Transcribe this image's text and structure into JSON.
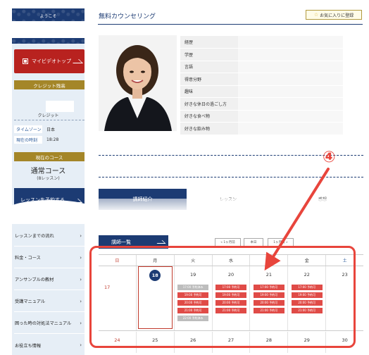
{
  "sidebar": {
    "welcome_label": "ようこそ",
    "mypage_button": "マイビデオトップ",
    "credit_header": "クレジット残高",
    "credit_label": "クレジット",
    "timezone_key": "タイムゾーン",
    "timezone_value": "日本",
    "current_time_key": "現在の時刻",
    "current_time_value": "18:28",
    "course_header": "現在のコース",
    "course_name": "通常コース",
    "course_sub": "(8レッスン)",
    "reserve_button": "レッスンを予約する",
    "menu": [
      "レッスンまでの流れ",
      "料金・コース",
      "アンサンブルの教材",
      "受講マニュアル",
      "困った時の対処法マニュアル",
      "お役立ち情報"
    ]
  },
  "main": {
    "title": "無料カウンセリング",
    "favorite_button": "お気に入りに登録",
    "profile_rows": [
      {
        "key": "経歴",
        "value": ""
      },
      {
        "key": "学歴",
        "value": ""
      },
      {
        "key": "言語",
        "value": ""
      },
      {
        "key": "得意分野",
        "value": ""
      },
      {
        "key": "趣味",
        "value": ""
      },
      {
        "key": "好きな休日の過ごし方",
        "value": ""
      },
      {
        "key": "好きな食べ物",
        "value": ""
      },
      {
        "key": "好きな飲み物",
        "value": ""
      }
    ],
    "tabs": [
      "講師紹介",
      "レッスン",
      "感想"
    ],
    "lecturer_list": "講師一覧",
    "nav": {
      "prev": "« 1ヶ月前",
      "today": "本日",
      "next": "1ヶ月後 »"
    },
    "calendar": {
      "weekdays": [
        "日",
        "月",
        "火",
        "水",
        "木",
        "金",
        "土"
      ],
      "week1": [
        "17",
        "18",
        "19",
        "20",
        "21",
        "22",
        "23"
      ],
      "week2": [
        "24",
        "25",
        "26",
        "27",
        "28",
        "29",
        "30"
      ],
      "slots": {
        "tue": [
          "17:00 予約済み",
          "19:00 予約可",
          "20:00 予約可",
          "21:00 予約可",
          "22:00 予約済み"
        ],
        "wed": [
          "17:00 予約可",
          "19:00 予約可",
          "20:00 予約可",
          "21:00 予約可"
        ],
        "thu": [
          "17:00 予約可",
          "19:00 予約可",
          "20:00 予約可",
          "21:00 予約可"
        ],
        "fri": [
          "17:00 予約可",
          "19:00 予約可",
          "20:00 予約可",
          "21:00 予約可"
        ]
      }
    }
  },
  "annotation": {
    "number": "④",
    "color": "#e8453c"
  },
  "colors": {
    "navy": "#1c3b73",
    "red": "#b8221f",
    "gold": "#a48628",
    "slot_red": "#e04b47"
  }
}
